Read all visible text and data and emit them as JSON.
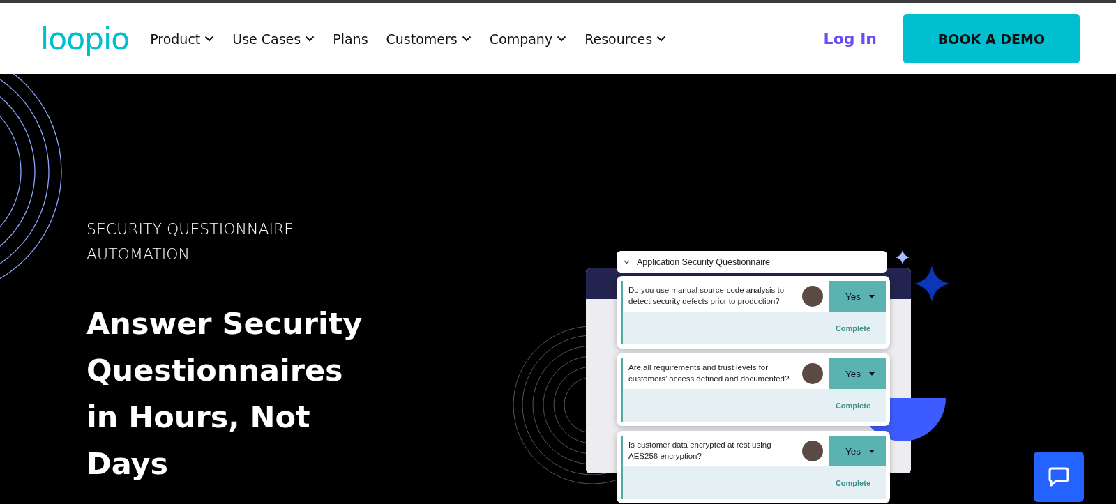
{
  "header": {
    "logo": "loopio",
    "nav": [
      {
        "label": "Product",
        "has_menu": true
      },
      {
        "label": "Use Cases",
        "has_menu": true
      },
      {
        "label": "Plans",
        "has_menu": false
      },
      {
        "label": "Customers",
        "has_menu": true
      },
      {
        "label": "Company",
        "has_menu": true
      },
      {
        "label": "Resources",
        "has_menu": true
      }
    ],
    "login": "Log In",
    "cta": "BOOK A DEMO"
  },
  "hero": {
    "eyebrow": "SECURITY QUESTIONNAIRE AUTOMATION",
    "heading": "Answer Security Questionnaires in Hours, Not Days"
  },
  "mockup": {
    "title": "Application Security Questionnaire",
    "questions": [
      {
        "question": "Do you use manual source-code analysis to detect security defects prior to production?",
        "answer": "Yes",
        "status": "Complete"
      },
      {
        "question": "Are all requirements and trust levels for customers’ access defined and documented?",
        "answer": "Yes",
        "status": "Complete"
      },
      {
        "question": "Is customer data encrypted at rest using AES256 encryption?",
        "answer": "Yes",
        "status": "Complete"
      }
    ]
  }
}
